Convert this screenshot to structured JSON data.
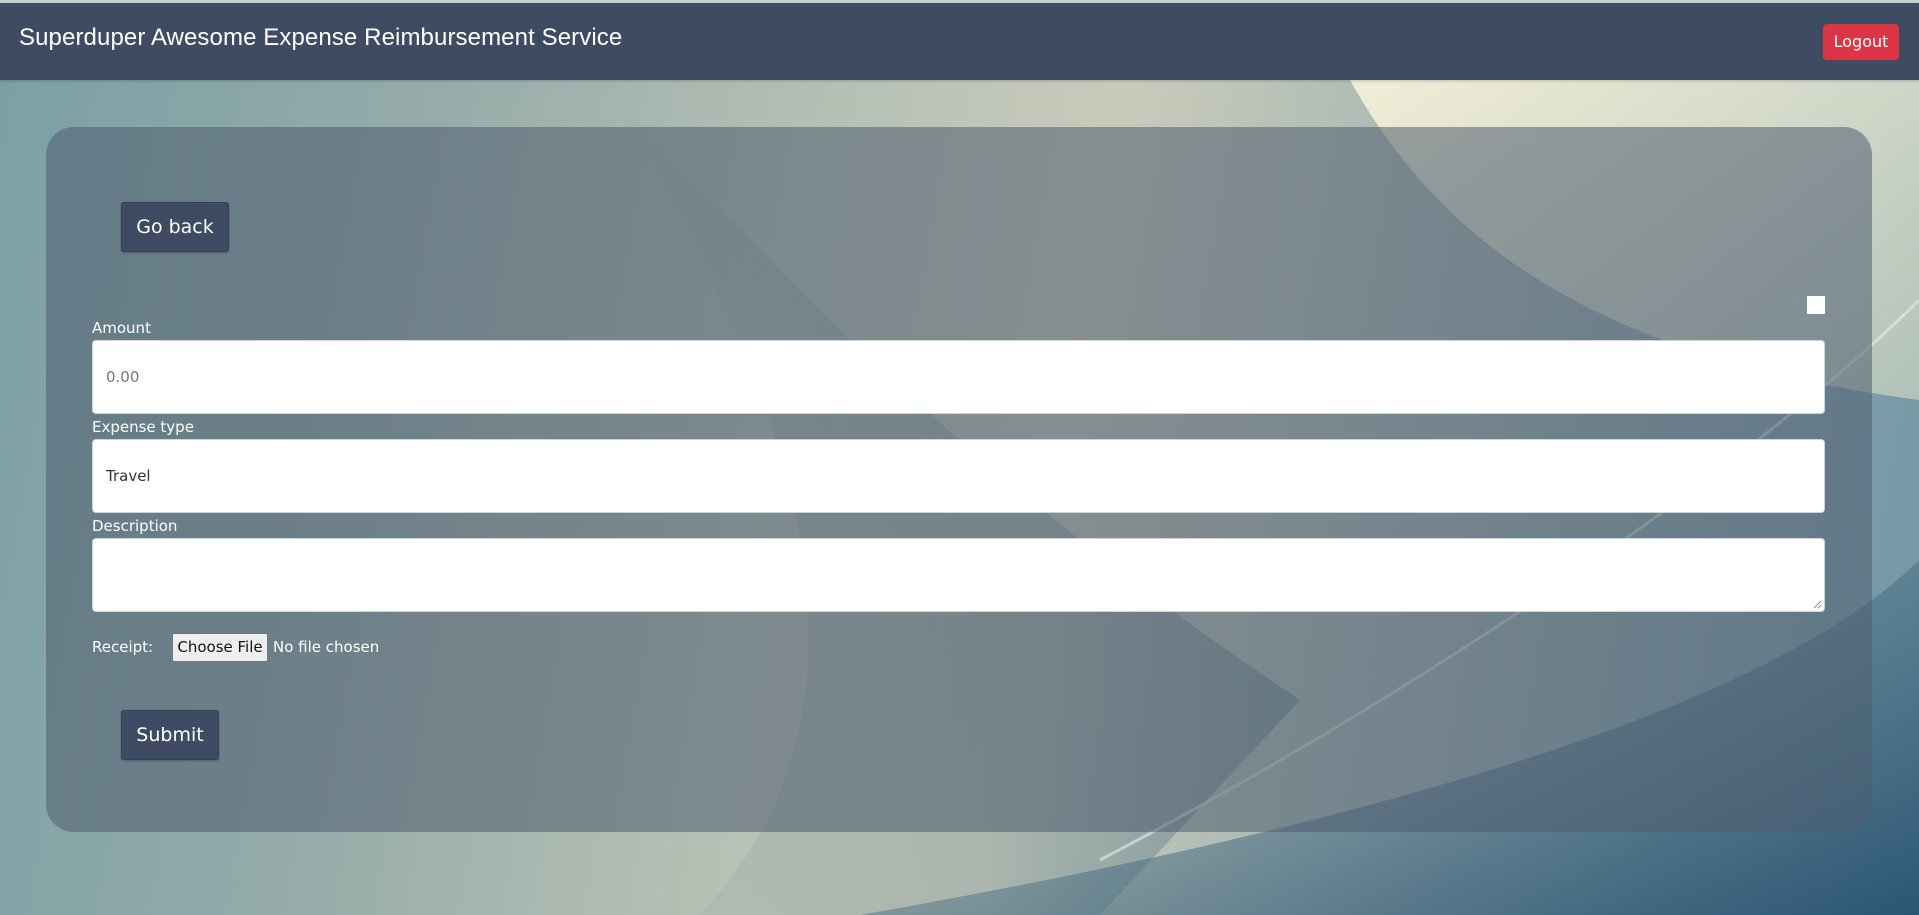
{
  "header": {
    "title": "Superduper Awesome Expense Reimbursement Service",
    "logout_label": "Logout"
  },
  "card": {
    "go_back_label": "Go back",
    "amount": {
      "label": "Amount",
      "placeholder": "0.00",
      "value": ""
    },
    "expense_type": {
      "label": "Expense type",
      "value": "Travel"
    },
    "description": {
      "label": "Description",
      "value": ""
    },
    "receipt": {
      "label": "Receipt:",
      "choose_file_label": "Choose File",
      "status": "No file chosen"
    },
    "submit_label": "Submit"
  },
  "colors": {
    "header_bg": "#3e4b63",
    "logout_bg": "#dc3545",
    "button_bg": "#3e4b63"
  }
}
